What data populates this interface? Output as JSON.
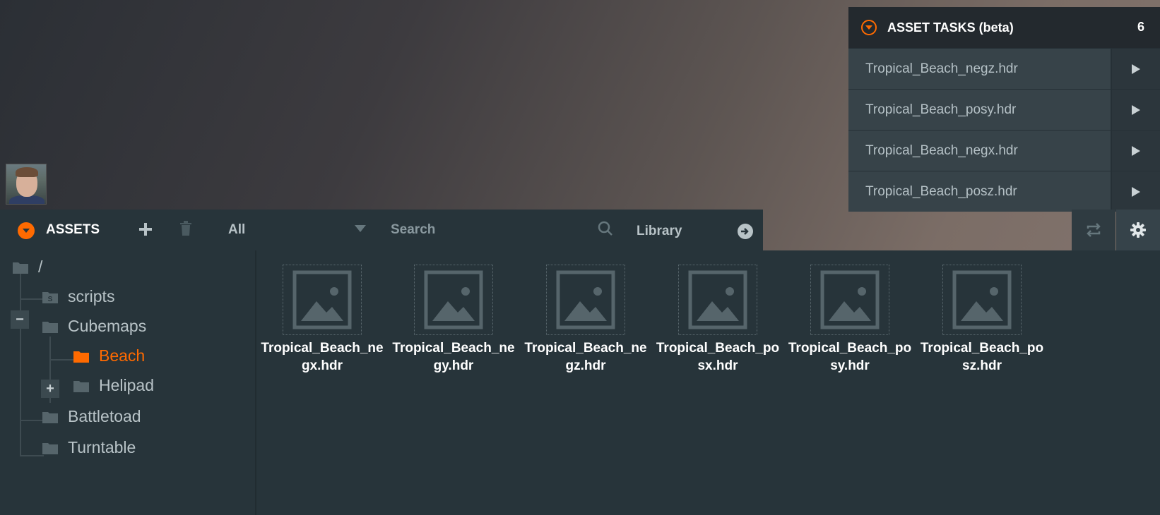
{
  "tasks": {
    "title": "ASSET TASKS (beta)",
    "count": "6",
    "items": [
      {
        "label": "Tropical_Beach_negz.hdr"
      },
      {
        "label": "Tropical_Beach_posy.hdr"
      },
      {
        "label": "Tropical_Beach_negx.hdr"
      },
      {
        "label": "Tropical_Beach_posz.hdr"
      }
    ]
  },
  "assets": {
    "title": "ASSETS",
    "filter_value": "All",
    "search_placeholder": "Search",
    "library_label": "Library"
  },
  "tree": {
    "root": "/",
    "items": [
      {
        "label": "scripts"
      },
      {
        "label": "Cubemaps"
      },
      {
        "label": "Beach"
      },
      {
        "label": "Helipad"
      },
      {
        "label": "Battletoad"
      },
      {
        "label": "Turntable"
      }
    ]
  },
  "grid": {
    "items": [
      {
        "label": "Tropical_Beach_negx.hdr"
      },
      {
        "label": "Tropical_Beach_negy.hdr"
      },
      {
        "label": "Tropical_Beach_negz.hdr"
      },
      {
        "label": "Tropical_Beach_posx.hdr"
      },
      {
        "label": "Tropical_Beach_posy.hdr"
      },
      {
        "label": "Tropical_Beach_posz.hdr"
      }
    ]
  },
  "icons": {
    "collapse": "caret-down-icon",
    "play": "play-icon",
    "sync": "sync-icon",
    "settings": "gear-icon",
    "add": "plus-icon",
    "delete": "trash-icon",
    "search": "search-icon",
    "go": "arrow-right-icon",
    "folder": "folder-icon",
    "image": "image-icon"
  },
  "colors": {
    "accent": "#ff6a00",
    "panel": "#27343a",
    "text_muted": "#b8c3c7"
  },
  "toggles": {
    "collapse": "−",
    "expand": "+"
  }
}
